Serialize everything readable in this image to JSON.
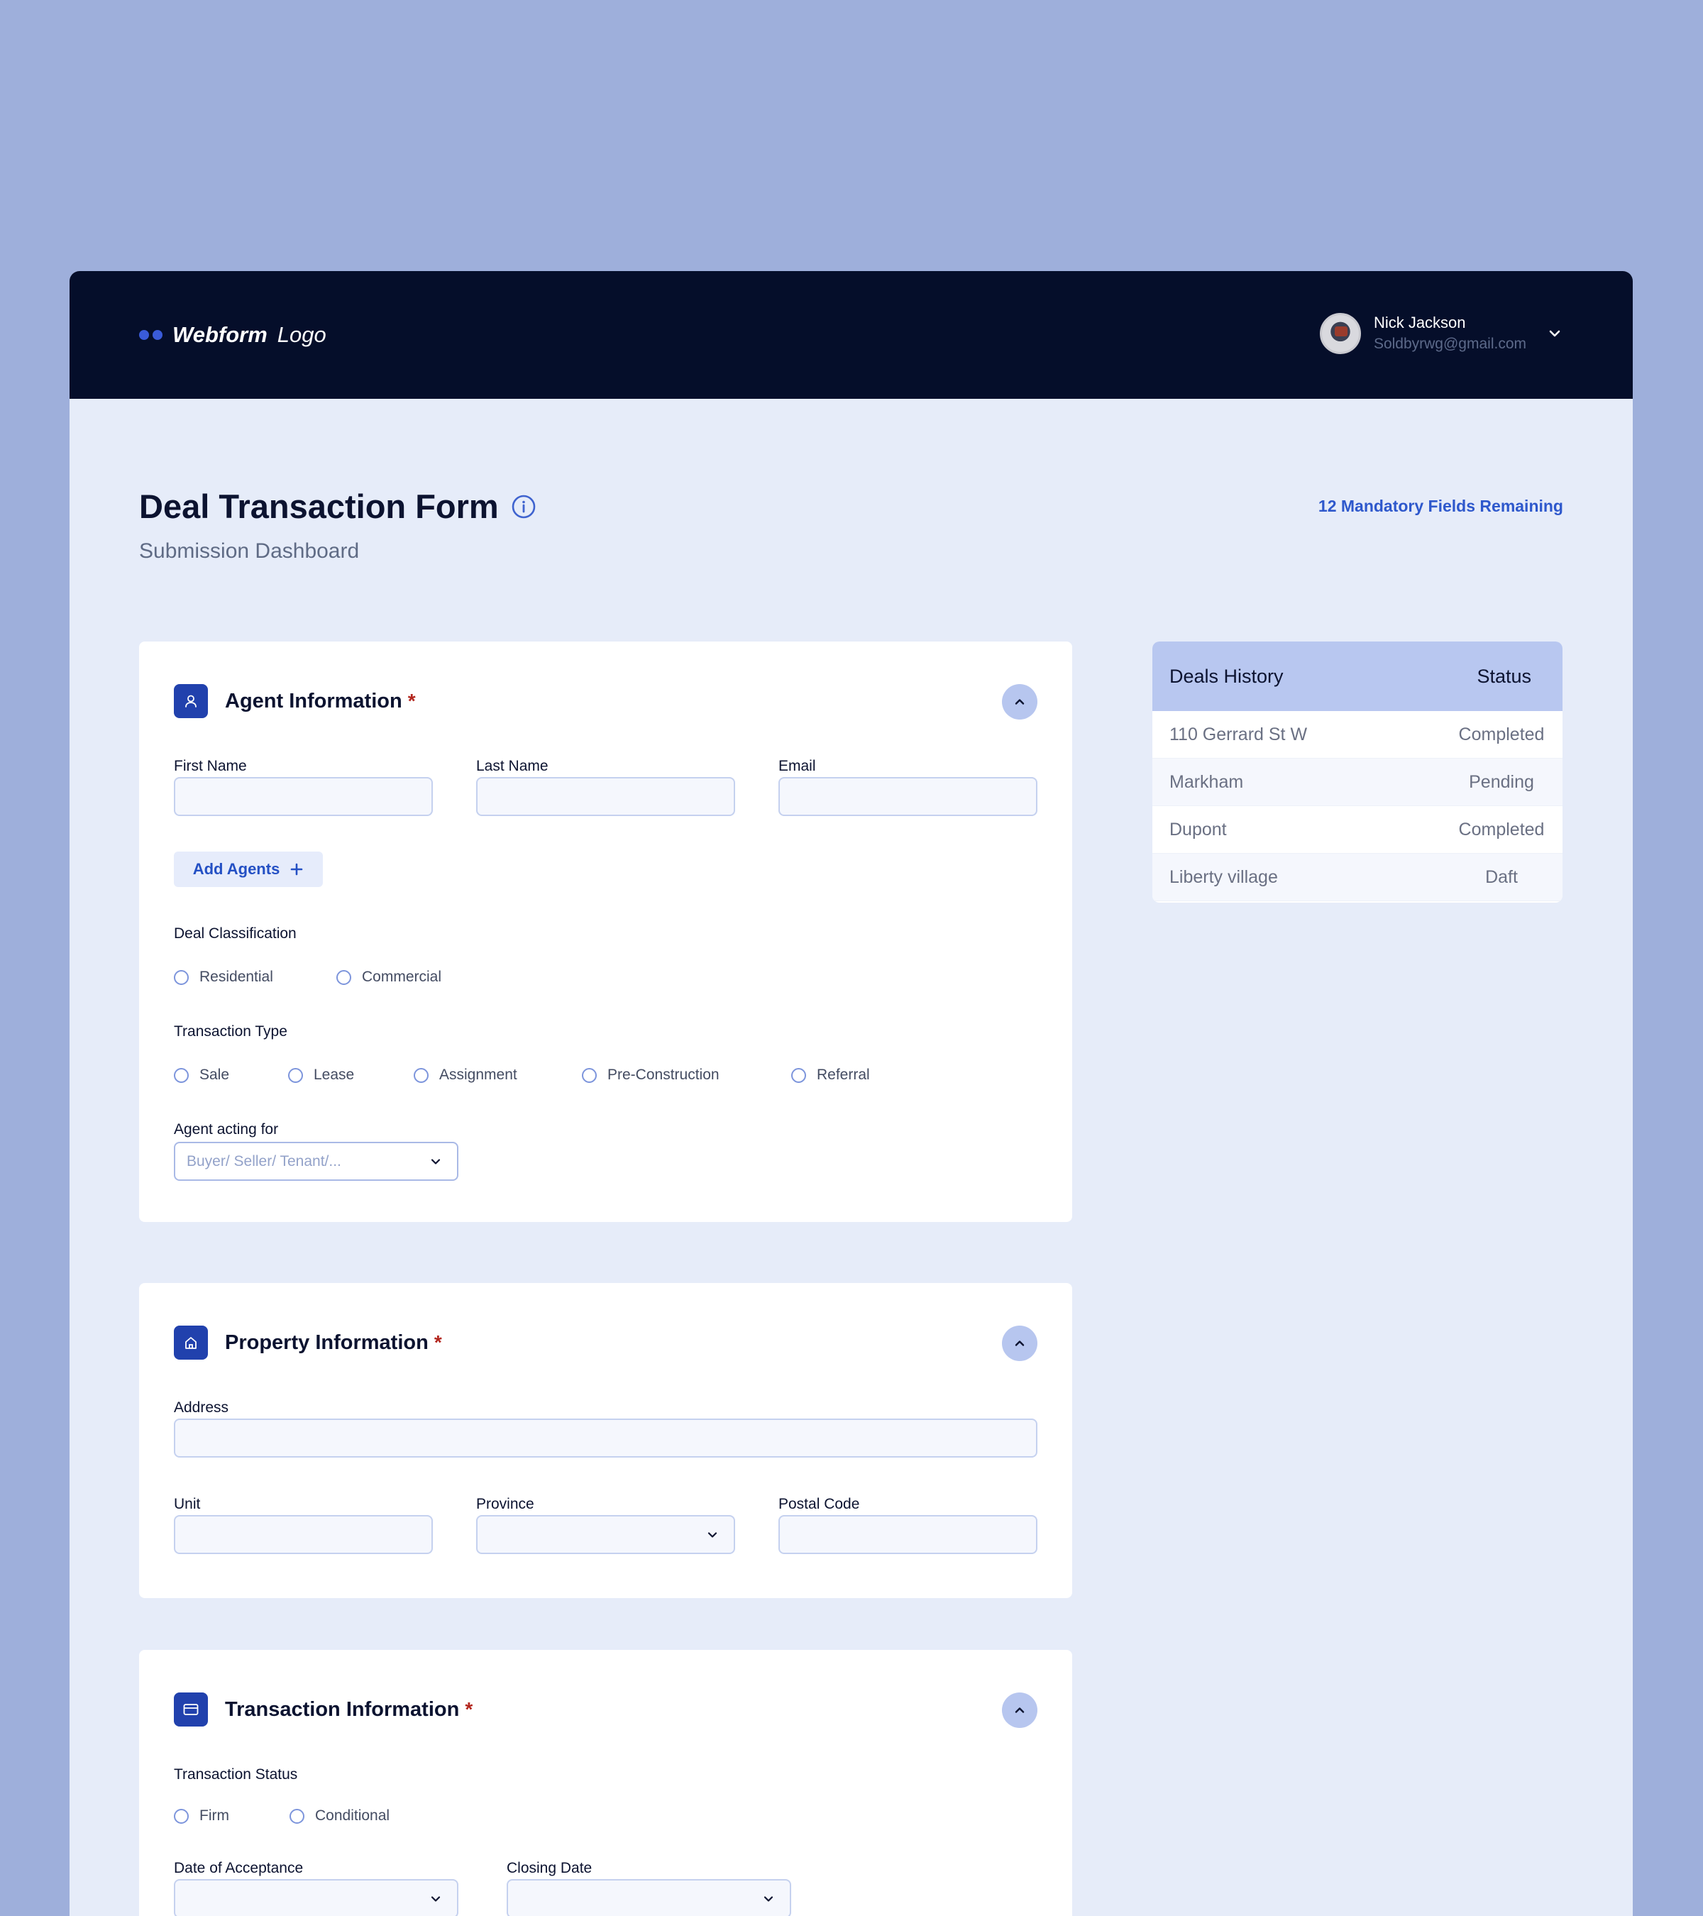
{
  "header": {
    "logo_bold": "Webform",
    "logo_light": "Logo",
    "user_name": "Nick Jackson",
    "user_email": "Soldbyrwg@gmail.com"
  },
  "page": {
    "title": "Deal Transaction Form",
    "subtitle": "Submission Dashboard",
    "mandatory_notice": "12 Mandatory Fields Remaining"
  },
  "agent_section": {
    "title": "Agent Information",
    "required_mark": "*",
    "first_name_label": "First Name",
    "last_name_label": "Last Name",
    "email_label": "Email",
    "add_agents_label": "Add Agents",
    "deal_classification_label": "Deal Classification",
    "deal_classification_options": [
      "Residential",
      "Commercial"
    ],
    "transaction_type_label": "Transaction Type",
    "transaction_type_options": [
      "Sale",
      "Lease",
      "Assignment",
      "Pre-Construction",
      "Referral"
    ],
    "acting_for_label": "Agent acting for",
    "acting_for_placeholder": "Buyer/ Seller/ Tenant/..."
  },
  "property_section": {
    "title": "Property Information",
    "required_mark": "*",
    "address_label": "Address",
    "unit_label": "Unit",
    "province_label": "Province",
    "postal_code_label": "Postal Code"
  },
  "transaction_section": {
    "title": "Transaction Information",
    "required_mark": "*",
    "status_label": "Transaction Status",
    "status_options": [
      "Firm",
      "Conditional"
    ],
    "acceptance_label": "Date of Acceptance",
    "closing_label": "Closing Date"
  },
  "deals_history": {
    "col_deal": "Deals History",
    "col_status": "Status",
    "rows": [
      {
        "deal": "110 Gerrard St W",
        "status": "Completed"
      },
      {
        "deal": "Markham",
        "status": "Pending"
      },
      {
        "deal": "Dupont",
        "status": "Completed"
      },
      {
        "deal": "Liberty village",
        "status": "Daft"
      }
    ]
  },
  "colors": {
    "page_bg": "#9eafdb",
    "topbar": "#050e2a",
    "accent": "#2141ad",
    "link": "#2e58cc",
    "required": "#b3261e"
  }
}
